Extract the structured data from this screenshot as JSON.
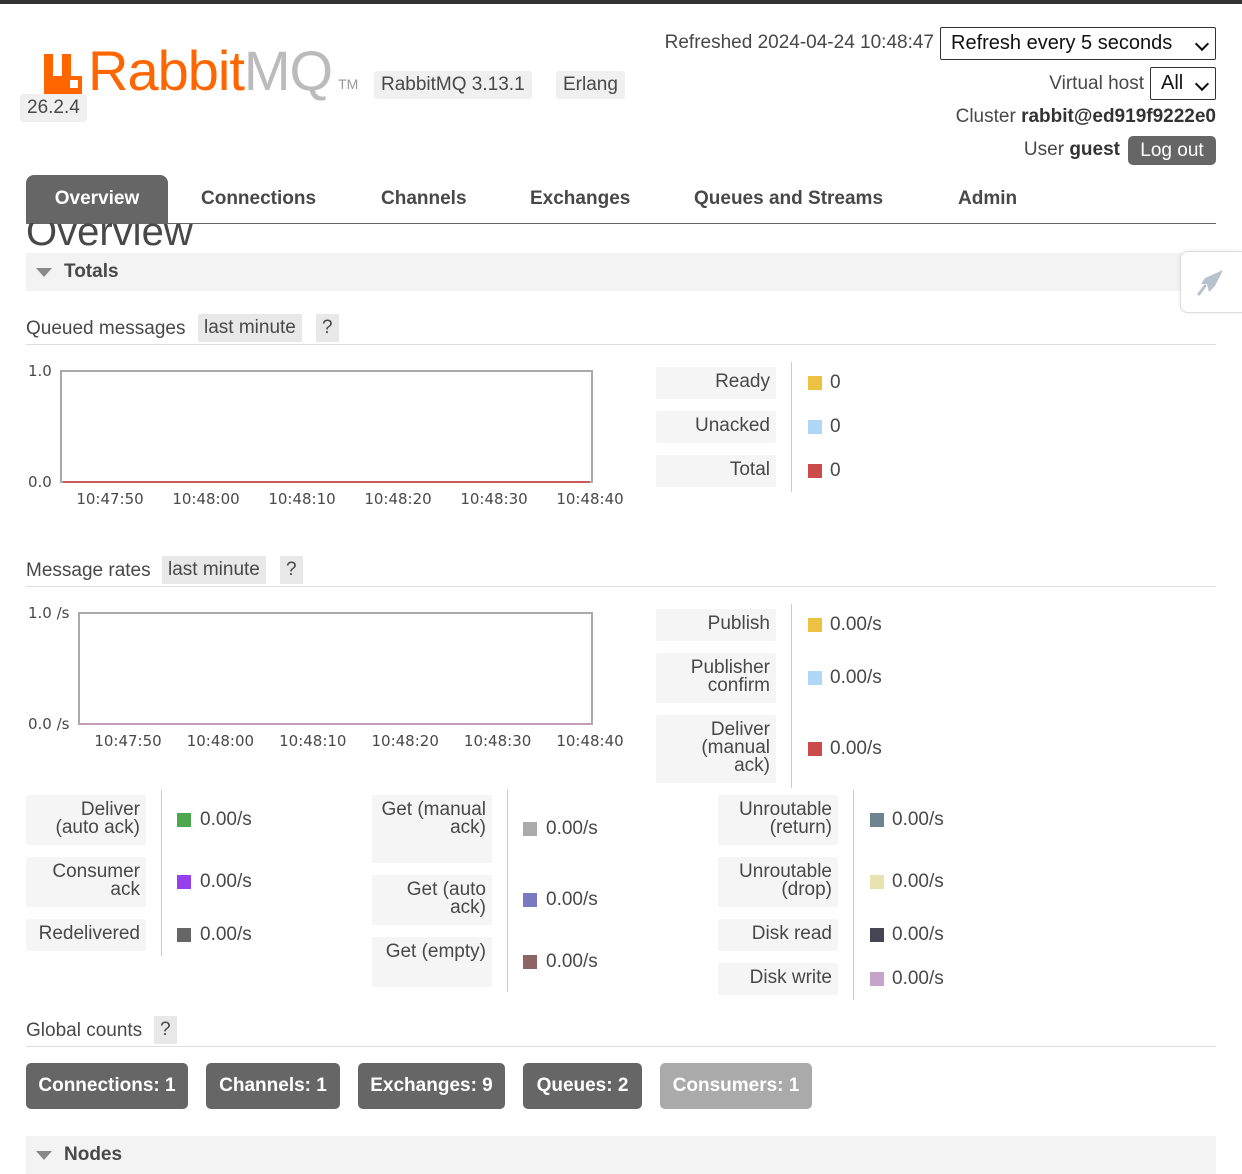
{
  "header": {
    "logo_rabbit": "Rabbit",
    "logo_mq": "MQ",
    "logo_tm": "TM",
    "version_label": "RabbitMQ 3.13.1",
    "erlang_label": "Erlang",
    "erlang_version": "26.2.4",
    "refreshed_text": "Refreshed 2024-04-24 10:48:47",
    "refresh_select": "Refresh every 5 seconds",
    "vhost_label": "Virtual host",
    "vhost_select": "All",
    "cluster_label": "Cluster",
    "cluster_name": "rabbit@ed919f9222e0",
    "user_label": "User",
    "user_name": "guest",
    "logout_label": "Log out"
  },
  "tabs": [
    "Overview",
    "Connections",
    "Channels",
    "Exchanges",
    "Queues and Streams",
    "Admin"
  ],
  "page_title": "Overview",
  "totals": {
    "title": "Totals",
    "queued_label": "Queued messages",
    "queued_range": "last minute",
    "rates_label": "Message rates",
    "rates_range": "last minute",
    "help": "?"
  },
  "queued_legend": [
    {
      "label": "Ready",
      "value": "0",
      "color": "#edc240"
    },
    {
      "label": "Unacked",
      "value": "0",
      "color": "#afd8f8"
    },
    {
      "label": "Total",
      "value": "0",
      "color": "#cb4b4b"
    }
  ],
  "rates_legend_top": [
    {
      "label": "Publish",
      "value": "0.00/s",
      "color": "#edc240"
    },
    {
      "label": "Publisher confirm",
      "value": "0.00/s",
      "color": "#afd8f8"
    },
    {
      "label": "Deliver (manual ack)",
      "value": "0.00/s",
      "color": "#cb4b4b"
    }
  ],
  "rates_legend_col1": [
    {
      "label": "Deliver (auto ack)",
      "value": "0.00/s",
      "color": "#4da74d"
    },
    {
      "label": "Consumer ack",
      "value": "0.00/s",
      "color": "#9440ed"
    },
    {
      "label": "Redelivered",
      "value": "0.00/s",
      "color": "#666666"
    }
  ],
  "rates_legend_col2": [
    {
      "label": "Get (manual ack)",
      "value": "0.00/s",
      "color": "#aaaaaa"
    },
    {
      "label": "Get (auto ack)",
      "value": "0.00/s",
      "color": "#7c79c3"
    },
    {
      "label": "Get (empty)",
      "value": "0.00/s",
      "color": "#8d6565"
    }
  ],
  "rates_legend_col3": [
    {
      "label": "Unroutable (return)",
      "value": "0.00/s",
      "color": "#6d8590"
    },
    {
      "label": "Unroutable (drop)",
      "value": "0.00/s",
      "color": "#e8e4b0"
    },
    {
      "label": "Disk read",
      "value": "0.00/s",
      "color": "#454553"
    },
    {
      "label": "Disk write",
      "value": "0.00/s",
      "color": "#c6a3c9"
    }
  ],
  "global_counts": {
    "title": "Global counts",
    "help": "?",
    "items": [
      {
        "label": "Connections: 1",
        "enabled": true
      },
      {
        "label": "Channels: 1",
        "enabled": true
      },
      {
        "label": "Exchanges: 9",
        "enabled": true
      },
      {
        "label": "Queues: 2",
        "enabled": true
      },
      {
        "label": "Consumers: 1",
        "enabled": false
      }
    ]
  },
  "nodes": {
    "title": "Nodes"
  },
  "chart_data": [
    {
      "type": "line",
      "x": [
        "10:47:50",
        "10:48:00",
        "10:48:10",
        "10:48:20",
        "10:48:30",
        "10:48:40"
      ],
      "ylim": [
        0.0,
        1.0
      ],
      "ytick_labels": [
        "1.0",
        "0.0"
      ],
      "series": [
        {
          "name": "Ready",
          "values": [
            0,
            0,
            0,
            0,
            0,
            0
          ],
          "color": "#edc240"
        },
        {
          "name": "Unacked",
          "values": [
            0,
            0,
            0,
            0,
            0,
            0
          ],
          "color": "#afd8f8"
        },
        {
          "name": "Total",
          "values": [
            0,
            0,
            0,
            0,
            0,
            0
          ],
          "color": "#cb4b4b"
        }
      ]
    },
    {
      "type": "line",
      "x": [
        "10:47:50",
        "10:48:00",
        "10:48:10",
        "10:48:20",
        "10:48:30",
        "10:48:40"
      ],
      "ylim": [
        0.0,
        1.0
      ],
      "ytick_labels": [
        "1.0 /s",
        "0.0 /s"
      ],
      "series": [
        {
          "name": "Publish",
          "values": [
            0,
            0,
            0,
            0,
            0,
            0
          ],
          "color": "#edc240"
        },
        {
          "name": "Deliver (manual ack)",
          "values": [
            0,
            0,
            0,
            0,
            0,
            0
          ],
          "color": "#cb4b4b"
        },
        {
          "name": "Disk write",
          "values": [
            0,
            0,
            0,
            0,
            0,
            0
          ],
          "color": "#c6a3c9"
        }
      ]
    }
  ]
}
